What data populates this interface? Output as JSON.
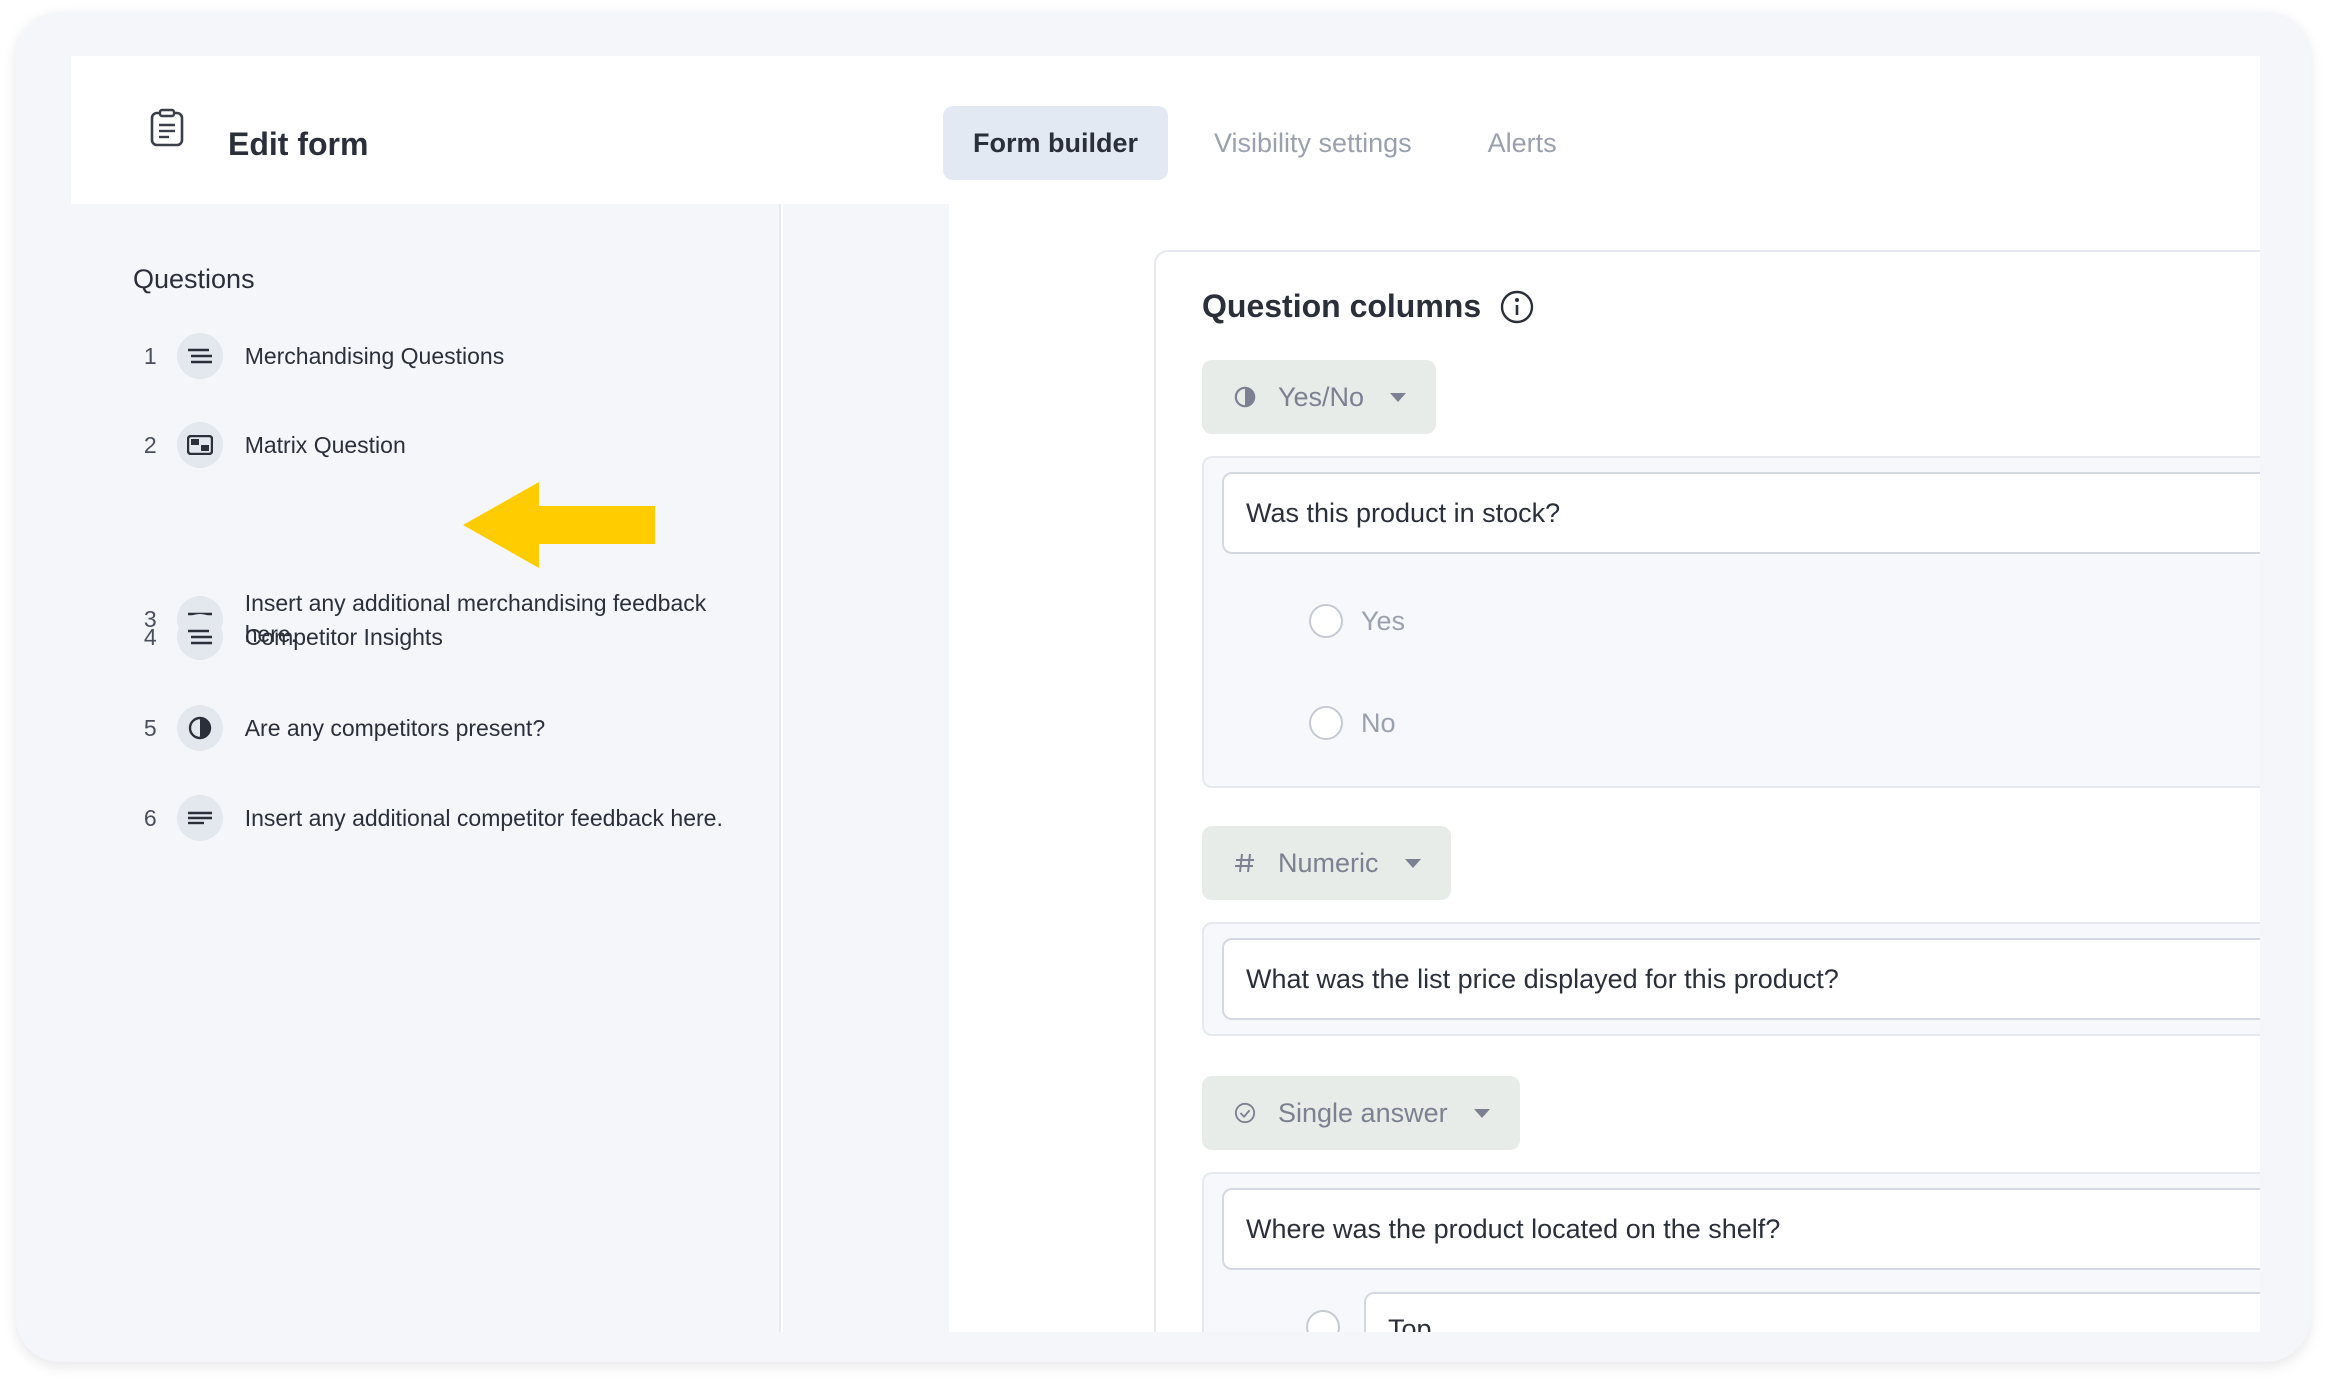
{
  "header": {
    "title": "Edit form",
    "tabs": [
      {
        "label": "Form builder",
        "active": true
      },
      {
        "label": "Visibility settings",
        "active": false
      },
      {
        "label": "Alerts",
        "active": false
      }
    ]
  },
  "sidebar": {
    "heading": "Questions",
    "items": [
      {
        "num": "1",
        "icon": "section-lines-icon",
        "label": "Merchandising Questions"
      },
      {
        "num": "2",
        "icon": "matrix-icon",
        "label": "Matrix Question"
      },
      {
        "num": "3",
        "icon": "text-lines-icon",
        "label": "Insert any additional merchandising feedback here."
      },
      {
        "num": "4",
        "icon": "section-lines-icon",
        "label": "Competitor Insights"
      },
      {
        "num": "5",
        "icon": "half-circle-icon",
        "label": "Are any competitors present?"
      },
      {
        "num": "6",
        "icon": "text-lines-icon",
        "label": "Insert any additional competitor feedback here."
      }
    ]
  },
  "annotation": {
    "icon": "arrow-left-icon",
    "color": "#FFCC00"
  },
  "main": {
    "card_title": "Question columns",
    "columns": [
      {
        "type_label": "Yes/No",
        "type_icon": "half-circle-icon",
        "question": "Was this product in stock?",
        "options": [
          "Yes",
          "No"
        ]
      },
      {
        "type_label": "Numeric",
        "type_icon": "hash-icon",
        "question": "What was the list price displayed for this product?"
      },
      {
        "type_label": "Single answer",
        "type_icon": "check-circle-icon",
        "question": "Where was the product located on the shelf?",
        "options": [
          "Top"
        ]
      }
    ]
  }
}
